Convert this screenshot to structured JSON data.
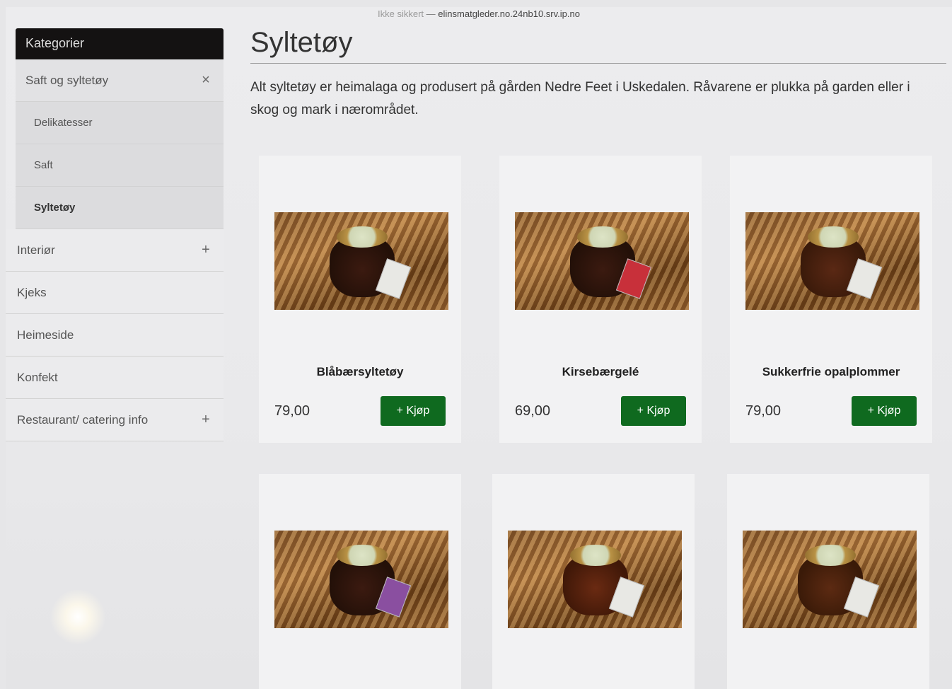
{
  "browser": {
    "insecure_label": "Ikke sikkert",
    "separator": "—",
    "url": "elinsmatgleder.no.24nb10.srv.ip.no"
  },
  "sidebar": {
    "header": "Kategorier",
    "open_category": {
      "label": "Saft og syltetøy",
      "control": "×"
    },
    "subitems": [
      {
        "label": "Delikatesser",
        "active": false
      },
      {
        "label": "Saft",
        "active": false
      },
      {
        "label": "Syltetøy",
        "active": true
      }
    ],
    "items": [
      {
        "label": "Interiør",
        "control": "+"
      },
      {
        "label": "Kjeks",
        "control": ""
      },
      {
        "label": "Heimeside",
        "control": ""
      },
      {
        "label": "Konfekt",
        "control": ""
      },
      {
        "label": "Restaurant/ catering info",
        "control": "+"
      }
    ]
  },
  "main": {
    "title": "Syltetøy",
    "description": "Alt syltetøy er heimalaga og produsert på gården Nedre Feet i Uskedalen. Råvarene er plukka på garden eller i skog og mark i nærområdet.",
    "products": [
      {
        "name": "Blåbærsyltetøy",
        "price": "79,00",
        "buy_label": "+ Kjøp"
      },
      {
        "name": "Kirsebærgelé",
        "price": "69,00",
        "buy_label": "+ Kjøp"
      },
      {
        "name": "Sukkerfrie opalplommer",
        "price": "79,00",
        "buy_label": "+ Kjøp"
      }
    ]
  },
  "colors": {
    "buy_button": "#0f6a1f",
    "category_header": "#141212"
  }
}
